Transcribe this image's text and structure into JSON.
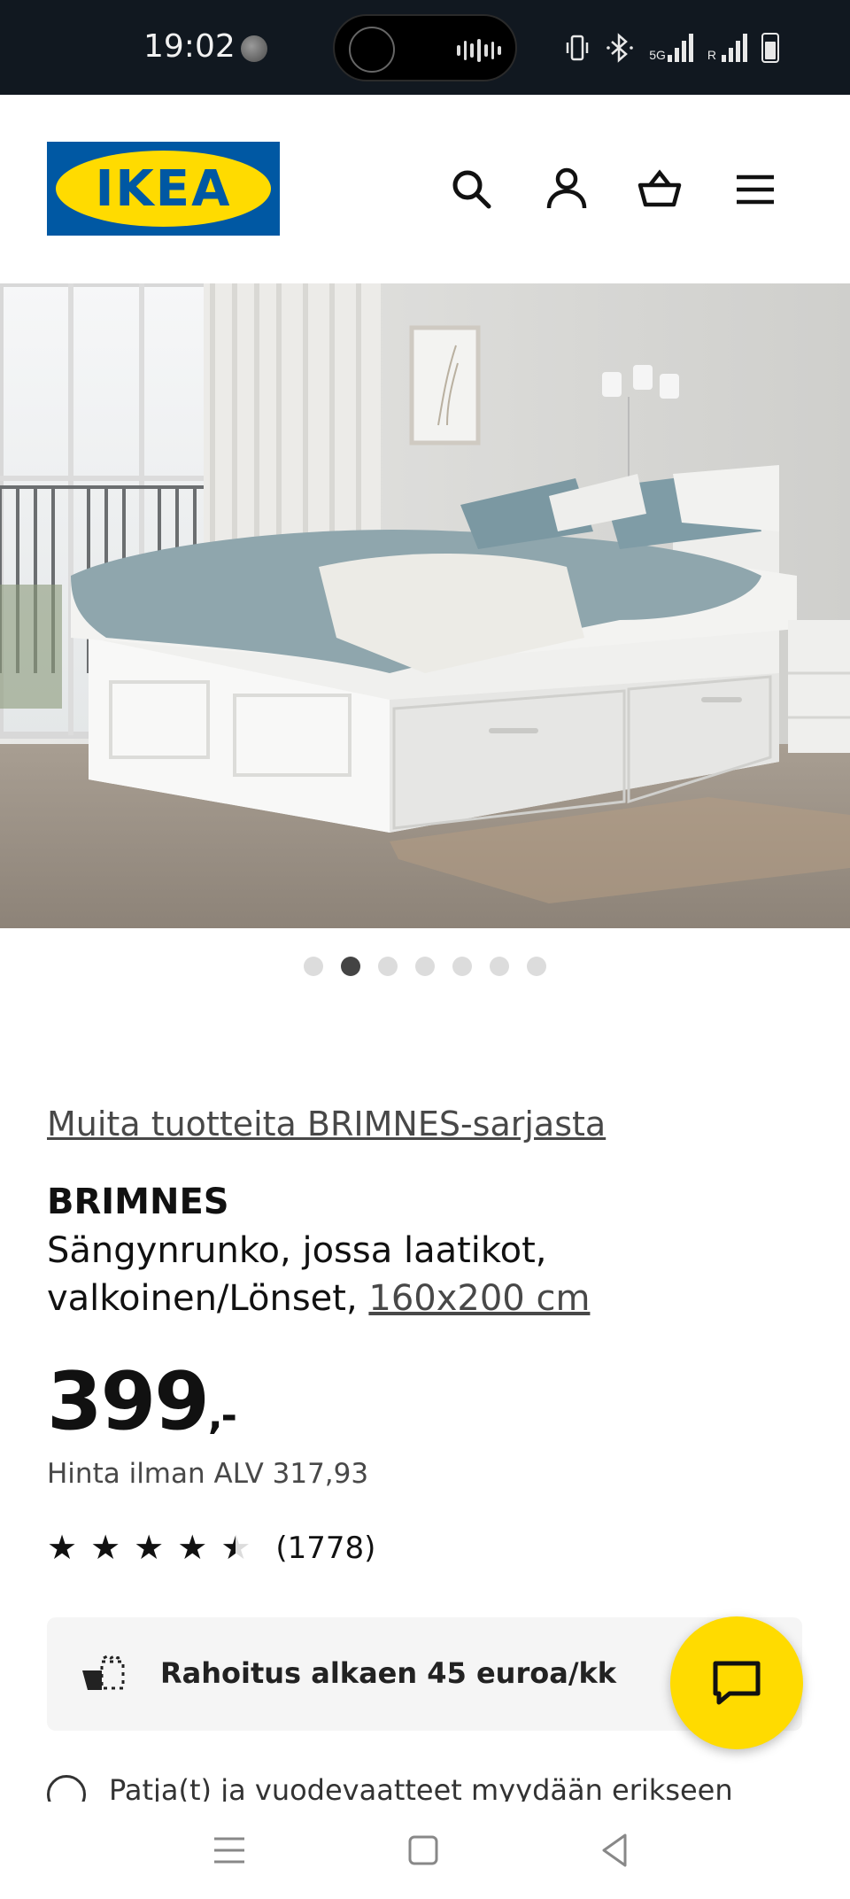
{
  "status_bar": {
    "time": "19:02",
    "network": "5G",
    "roaming": "R",
    "icons": [
      "moon-icon",
      "vibrate-icon",
      "bluetooth-icon",
      "signal-5g-icon",
      "signal-icon",
      "battery-icon"
    ]
  },
  "header": {
    "logo_text": "IKEA",
    "icons": [
      "search-icon",
      "account-icon",
      "basket-icon",
      "menu-icon"
    ]
  },
  "gallery": {
    "image_description": "product-photo",
    "dots_total": 7,
    "active_index": 1
  },
  "product": {
    "series_link": "Muita tuotteita BRIMNES-sarjasta",
    "name": "BRIMNES",
    "desc_part1": "Sängynrunko, jossa laatikot, valkoinen/Lönset,",
    "size_link": "160x200 cm",
    "price": "399",
    "price_suffix": ",-",
    "vat_text": "Hinta ilman ALV 317,93",
    "rating_value": 4.5,
    "review_count": "(1778)"
  },
  "finance": {
    "label": "Rahoitus alkaen 45 euroa/kk"
  },
  "info": {
    "text": "Patja(t) ja vuodevaatteet myydään erikseen"
  },
  "colors": {
    "ikea_blue": "#0058a3",
    "ikea_yellow": "#ffdb00",
    "status_bar_bg": "#111820"
  }
}
